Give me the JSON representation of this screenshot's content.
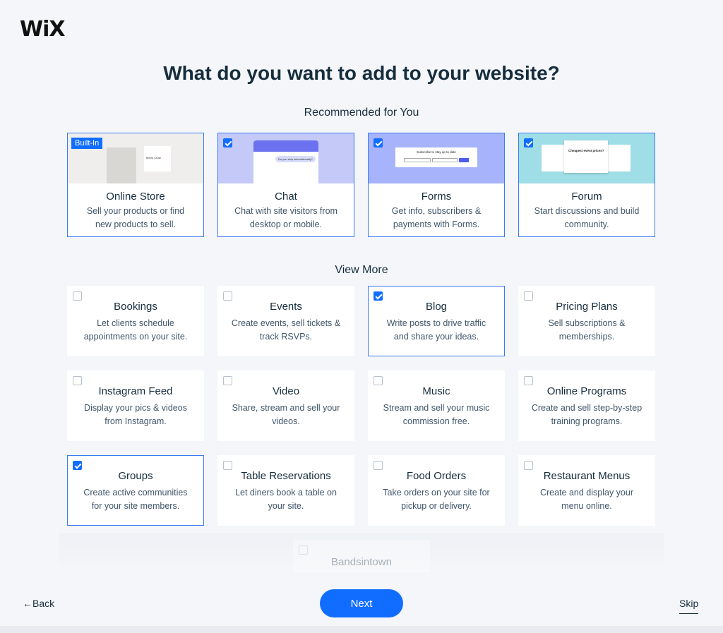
{
  "logo": "WiX",
  "title": "What do you want to add to your website?",
  "recommended_label": "Recommended for You",
  "view_more_label": "View More",
  "recommended": [
    {
      "title": "Online Store",
      "desc": "Sell your products or find new products to sell.",
      "badge": "Built-In",
      "thumb_text": "Metro Chair",
      "thumb_color": "#efeeec"
    },
    {
      "title": "Chat",
      "desc": "Chat with site visitors from desktop or mobile.",
      "checked": true,
      "thumb_text": "Do you ship internationally?",
      "thumb_color": "#c4c9f7"
    },
    {
      "title": "Forms",
      "desc": "Get info, subscribers & payments with Forms.",
      "checked": true,
      "thumb_text": "Subscribe to stay up to date",
      "thumb_color": "#a7b3fb"
    },
    {
      "title": "Forum",
      "desc": "Start discussions and build community.",
      "checked": true,
      "thumb_text": "Cheapest event prices?",
      "thumb_color": "#9fdde7"
    }
  ],
  "view_more": [
    {
      "title": "Bookings",
      "desc": "Let clients schedule appointments on your site.",
      "checked": false
    },
    {
      "title": "Events",
      "desc": "Create events, sell tickets & track RSVPs.",
      "checked": false
    },
    {
      "title": "Blog",
      "desc": "Write posts to drive traffic and share your ideas.",
      "checked": true
    },
    {
      "title": "Pricing Plans",
      "desc": "Sell subscriptions & memberships.",
      "checked": false
    },
    {
      "title": "Instagram Feed",
      "desc": "Display your pics & videos from Instagram.",
      "checked": false
    },
    {
      "title": "Video",
      "desc": "Share, stream and sell your videos.",
      "checked": false
    },
    {
      "title": "Music",
      "desc": "Stream and sell your music commission free.",
      "checked": false
    },
    {
      "title": "Online Programs",
      "desc": "Create and sell step-by-step training programs.",
      "checked": false
    },
    {
      "title": "Groups",
      "desc": "Create active communities for your site members.",
      "checked": true
    },
    {
      "title": "Table Reservations",
      "desc": "Let diners book a table on your site.",
      "checked": false
    },
    {
      "title": "Food Orders",
      "desc": "Take orders on your site for pickup or delivery.",
      "checked": false
    },
    {
      "title": "Restaurant Menus",
      "desc": "Create and display your menu online.",
      "checked": false
    },
    {
      "title": "Bandsintown",
      "checked": false
    }
  ],
  "footer": {
    "back": "←Back",
    "next": "Next",
    "skip": "Skip"
  },
  "colors": {
    "accent": "#116dff",
    "border_selected": "#3b7bf2"
  }
}
